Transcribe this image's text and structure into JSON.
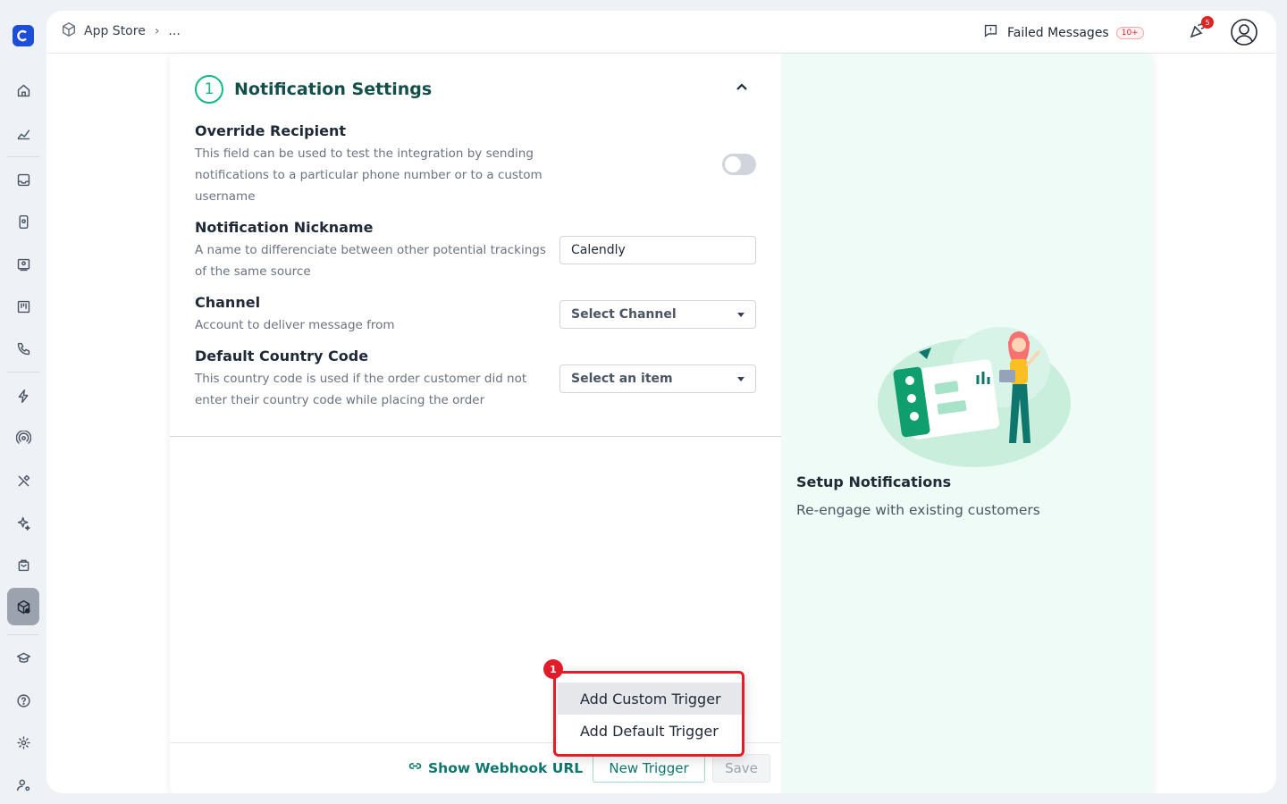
{
  "breadcrumb": {
    "root": "App Store",
    "more": "..."
  },
  "header": {
    "failed_label": "Failed Messages",
    "failed_badge": "10+",
    "notif_count": "5"
  },
  "section": {
    "step": "1",
    "title": "Notification Settings"
  },
  "fields": {
    "override": {
      "label": "Override Recipient",
      "desc": "This field can be used to test the integration by sending notifications to a particular phone number or to a custom username",
      "enabled": false
    },
    "nickname": {
      "label": "Notification Nickname",
      "desc": "A name to differenciate between other potential trackings of the same source",
      "value": "Calendly"
    },
    "channel": {
      "label": "Channel",
      "desc": "Account to deliver message from",
      "selected": "Select Channel"
    },
    "country": {
      "label": "Default Country Code",
      "desc": "This country code is used if the order customer did not enter their country code while placing the order",
      "selected": "Select an item"
    }
  },
  "footer": {
    "webhook": "Show Webhook URL",
    "new_trigger": "New Trigger",
    "save": "Save"
  },
  "menu": {
    "items": [
      "Add Custom Trigger",
      "Add Default Trigger"
    ],
    "highlight_index": "1"
  },
  "promo": {
    "title": "Setup Notifications",
    "subtitle": "Re-engage with existing customers"
  },
  "colors": {
    "accent": "#10b981",
    "brand": "#1d4ed8",
    "highlight": "#e11d2a",
    "promo_bg": "#effbf6"
  },
  "rail_icons": [
    "home-icon",
    "analytics-icon",
    "inbox-icon",
    "contacts-icon",
    "campaign-icon",
    "board-icon",
    "phone-icon",
    "bolt-icon",
    "broadcast-icon",
    "tools-icon",
    "sparkle-icon",
    "bag-icon",
    "app-store-icon",
    "academy-icon",
    "help-icon",
    "settings-icon",
    "user-settings-icon"
  ]
}
